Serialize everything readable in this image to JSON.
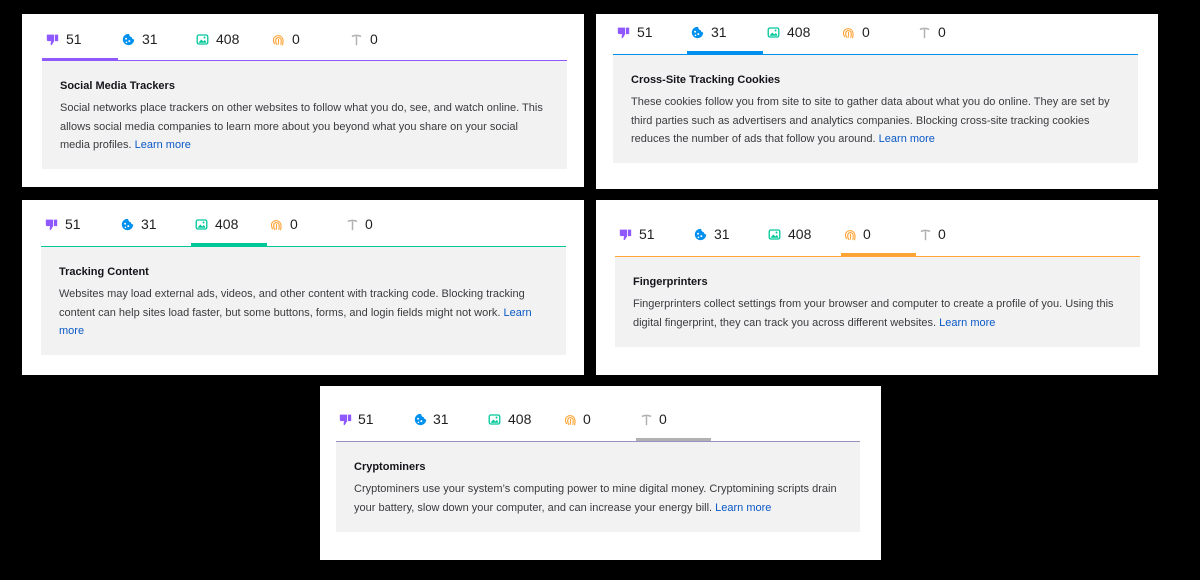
{
  "tab_counts": {
    "social_media_trackers": "51",
    "cross_site_cookies": "31",
    "tracking_content": "408",
    "fingerprinters": "0",
    "cryptominers": "0"
  },
  "colors": {
    "social": "#9059ff",
    "cookies": "#0090ed",
    "content": "#00c79a",
    "fingerprint": "#ffa436",
    "crypto": "#b1b1b3",
    "link": "#0a59c7"
  },
  "icons": {
    "social": "thumbs-down-icon",
    "cookies": "cookie-icon",
    "content": "image-icon",
    "fingerprint": "fingerprint-icon",
    "crypto": "pickaxe-icon"
  },
  "learn_more_label": "Learn more",
  "panels": [
    {
      "active_tab": "social",
      "title": "Social Media Trackers",
      "body": "Social networks place trackers on other websites to follow what you do, see, and watch online. This allows social media companies to learn more about you beyond what you share on your social media profiles."
    },
    {
      "active_tab": "cookies",
      "title": "Cross-Site Tracking Cookies",
      "body": "These cookies follow you from site to site to gather data about what you do online. They are set by third parties such as advertisers and analytics companies. Blocking cross-site tracking cookies reduces the number of ads that follow you around."
    },
    {
      "active_tab": "content",
      "title": "Tracking Content",
      "body": "Websites may load external ads, videos, and other content with tracking code. Blocking tracking content can help sites load faster, but some buttons, forms, and login fields might not work."
    },
    {
      "active_tab": "fingerprint",
      "title": "Fingerprinters",
      "body": "Fingerprinters collect settings from your browser and computer to create a profile of you. Using this digital fingerprint, they can track you across different websites."
    },
    {
      "active_tab": "crypto",
      "title": "Cryptominers",
      "body": "Cryptominers use your system’s computing power to mine digital money. Cryptomining scripts drain your battery, slow down your computer, and can increase your energy bill."
    }
  ]
}
